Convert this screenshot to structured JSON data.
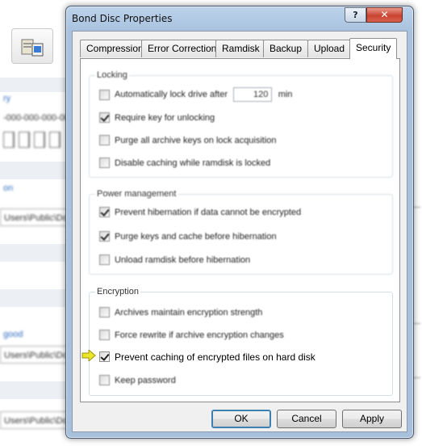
{
  "background_app": {
    "rows": [
      {
        "text": "ry",
        "kind": "link"
      },
      {
        "text": "-000-000-000-00",
        "kind": "text"
      },
      {
        "text": "on",
        "kind": "link"
      },
      {
        "text": "Users\\Public\\Do",
        "kind": "input"
      },
      {
        "text": "good",
        "kind": "link"
      },
      {
        "text": "Users\\Public\\Do",
        "kind": "input"
      },
      {
        "text": "Users\\Public\\Do",
        "kind": "input"
      }
    ]
  },
  "window": {
    "title": "Bond Disc Properties",
    "help_label": "?",
    "close_label": "✕"
  },
  "tabs": [
    {
      "label": "Compression",
      "selected": false
    },
    {
      "label": "Error Correction",
      "selected": false
    },
    {
      "label": "Ramdisk",
      "selected": false
    },
    {
      "label": "Backup",
      "selected": false
    },
    {
      "label": "Upload",
      "selected": false
    },
    {
      "label": "Security",
      "selected": true
    }
  ],
  "groups": {
    "locking": {
      "label": "Locking",
      "auto_lock": {
        "label": "Automatically lock drive after",
        "checked": false,
        "value": "120",
        "unit": "min"
      },
      "require_key": {
        "label": "Require key for unlocking",
        "checked": true
      },
      "purge_keys": {
        "label": "Purge all archive keys on lock acquisition",
        "checked": false
      },
      "disable_caching": {
        "label": "Disable caching while ramdisk is locked",
        "checked": false
      }
    },
    "power": {
      "label": "Power management",
      "prevent_hibernation": {
        "label": "Prevent hibernation if data cannot be encrypted",
        "checked": true
      },
      "purge_before_hibernation": {
        "label": "Purge keys and cache before hibernation",
        "checked": true
      },
      "unload_ramdisk": {
        "label": "Unload ramdisk before hibernation",
        "checked": false
      }
    },
    "encryption": {
      "label": "Encryption",
      "maintain_strength": {
        "label": "Archives maintain encryption strength",
        "checked": false
      },
      "force_rewrite": {
        "label": "Force rewrite if archive encryption changes",
        "checked": false
      },
      "prevent_caching": {
        "label": "Prevent caching of encrypted files on hard disk",
        "checked": true
      },
      "keep_password": {
        "label": "Keep password",
        "checked": false
      }
    }
  },
  "buttons": {
    "ok": "OK",
    "cancel": "Cancel",
    "apply": "Apply"
  },
  "colors": {
    "window_frame": "#a9c3df",
    "close_button": "#c84431",
    "highlight_arrow": "#e8e000"
  }
}
